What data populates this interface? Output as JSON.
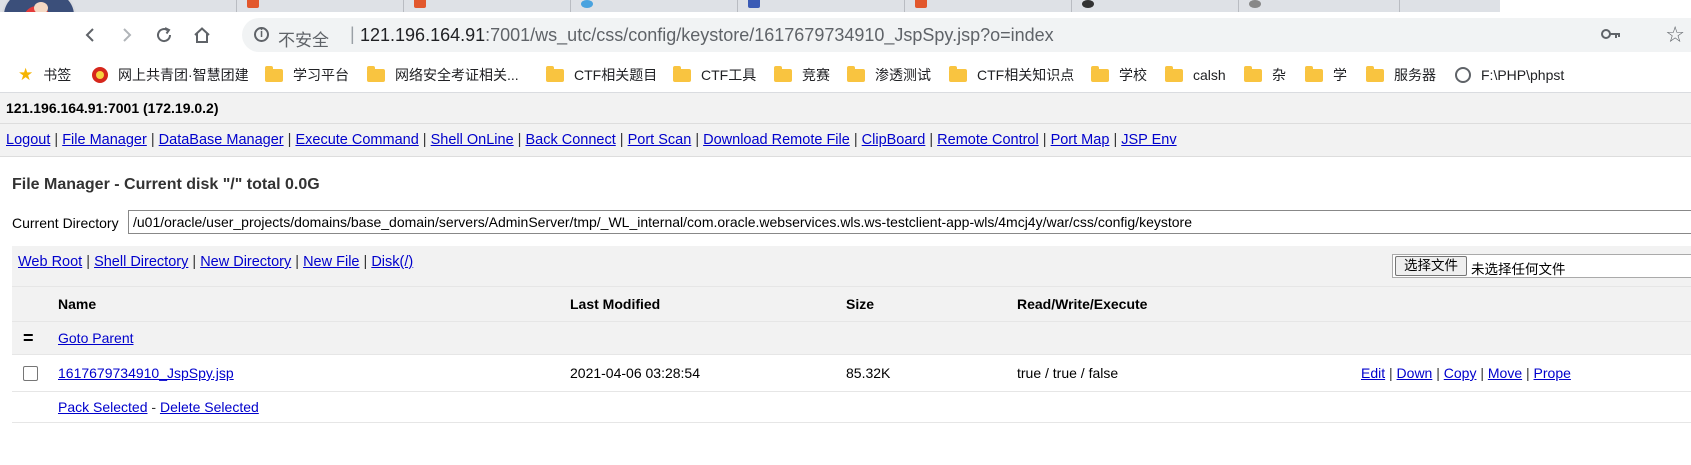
{
  "browser": {
    "insecure_label": "不安全",
    "url_host": "121.196.164.91",
    "url_rest": ":7001/ws_utc/css/config/keystore/1617679734910_JspSpy.jsp?o=index",
    "bookmarks": [
      {
        "label": "书签",
        "icon": "star-icon"
      },
      {
        "label": "网上共青团·智慧团建",
        "icon": "party-emblem-icon"
      },
      {
        "label": "学习平台",
        "icon": "folder-icon"
      },
      {
        "label": "网络安全考证相关...",
        "icon": "folder-icon"
      },
      {
        "label": "CTF相关题目",
        "icon": "folder-icon"
      },
      {
        "label": "CTF工具",
        "icon": "folder-icon"
      },
      {
        "label": "竞赛",
        "icon": "folder-icon"
      },
      {
        "label": "渗透测试",
        "icon": "folder-icon"
      },
      {
        "label": "CTF相关知识点",
        "icon": "folder-icon"
      },
      {
        "label": "学校",
        "icon": "folder-icon"
      },
      {
        "label": "calsh",
        "icon": "folder-icon"
      },
      {
        "label": "杂",
        "icon": "folder-icon"
      },
      {
        "label": "学",
        "icon": "folder-icon"
      },
      {
        "label": "服务器",
        "icon": "folder-icon"
      },
      {
        "label": "F:\\PHP\\phpst",
        "icon": "globe-icon"
      }
    ]
  },
  "page": {
    "host": "121.196.164.91:7001 (172.19.0.2)",
    "menu": [
      "Logout",
      "File Manager",
      "DataBase Manager",
      "Execute Command",
      "Shell OnLine",
      "Back Connect",
      "Port Scan",
      "Download Remote File",
      "ClipBoard",
      "Remote Control",
      "Port Map",
      "JSP Env"
    ],
    "title": "File Manager - Current disk \"/\" total 0.0G",
    "current_dir_label": "Current Directory",
    "current_dir": "/u01/oracle/user_projects/domains/base_domain/servers/AdminServer/tmp/_WL_internal/com.oracle.webservices.wls.ws-testclient-app-wls/4mcj4y/war/css/config/keystore",
    "quick_links": [
      "Web Root",
      "Shell Directory",
      "New Directory",
      "New File",
      "Disk(/)"
    ],
    "file_button": "选择文件",
    "file_none": "未选择任何文件",
    "columns": {
      "name": "Name",
      "modified": "Last Modified",
      "size": "Size",
      "rwx": "Read/Write/Execute"
    },
    "parent_symbol": "=",
    "goto_parent": "Goto Parent",
    "files": [
      {
        "name": "1617679734910_JspSpy.jsp",
        "modified": "2021-04-06 03:28:54",
        "size": "85.32K",
        "rwx": "true / true / false"
      }
    ],
    "file_actions": [
      "Edit",
      "Down",
      "Copy",
      "Move",
      "Prope"
    ],
    "pack_selected": "Pack Selected",
    "delete_selected": "Delete Selected",
    "delete_sep": "-"
  }
}
